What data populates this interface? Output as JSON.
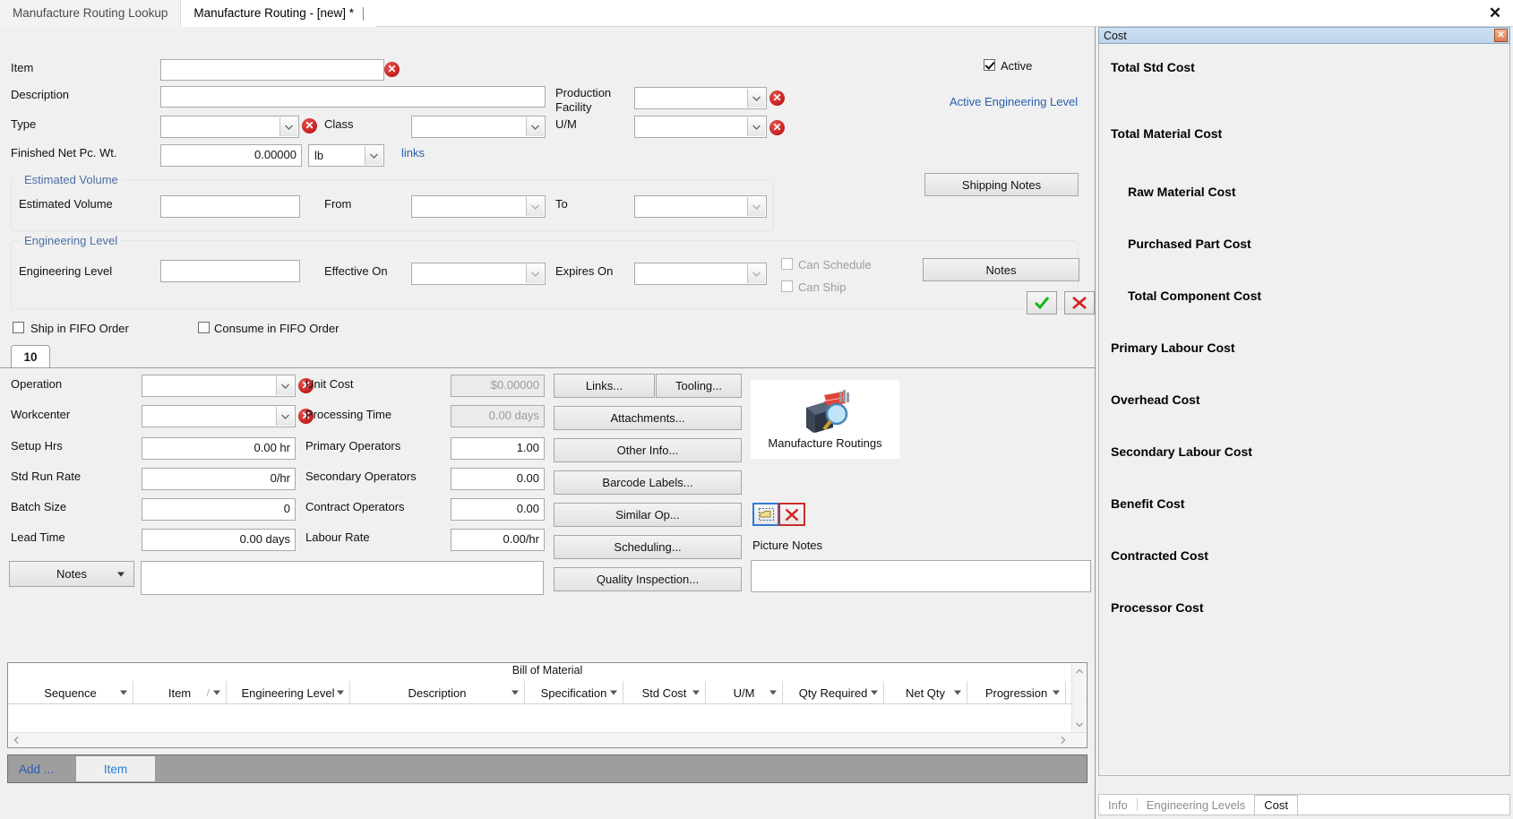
{
  "window": {
    "close_label": "✕"
  },
  "tabs": [
    {
      "label": "Manufacture Routing Lookup",
      "active": false
    },
    {
      "label": "Manufacture Routing - [new] *",
      "active": true
    }
  ],
  "header": {
    "item_label": "Item",
    "item_value": "",
    "description_label": "Description",
    "description_value": "",
    "type_label": "Type",
    "type_value": "",
    "class_label": "Class",
    "class_value": "",
    "finished_net_label": "Finished Net Pc. Wt.",
    "finished_net_value": "0.00000",
    "uom_unit_value": "lb",
    "links_label": "links",
    "production_facility_label_1": "Production",
    "production_facility_label_2": "Facility",
    "production_facility_value": "",
    "um_label": "U/M",
    "um_value": "",
    "active_label": "Active",
    "active_engineering_level_link": "Active Engineering Level",
    "shipping_notes_button": "Shipping Notes",
    "notes_button": "Notes",
    "error_badge": "✕"
  },
  "estimated_volume": {
    "group_title": "Estimated Volume",
    "field_label": "Estimated Volume",
    "field_value": "",
    "from_label": "From",
    "from_value": "",
    "to_label": "To",
    "to_value": ""
  },
  "engineering_level": {
    "group_title": "Engineering Level",
    "field_label": "Engineering Level",
    "field_value": "",
    "effective_on_label": "Effective On",
    "effective_on_value": "",
    "expires_on_label": "Expires On",
    "expires_on_value": "",
    "can_schedule_label": "Can Schedule",
    "can_ship_label": "Can Ship"
  },
  "fifo": {
    "ship_label": "Ship in FIFO Order",
    "consume_label": "Consume in FIFO Order"
  },
  "operation": {
    "tab_label": "10",
    "operation_label": "Operation",
    "operation_value": "",
    "workcenter_label": "Workcenter",
    "workcenter_value": "",
    "setup_hrs_label": "Setup Hrs",
    "setup_hrs_value": "0.00 hr",
    "std_run_rate_label": "Std Run Rate",
    "std_run_rate_value": "0/hr",
    "batch_size_label": "Batch Size",
    "batch_size_value": "0",
    "lead_time_label": "Lead Time",
    "lead_time_value": "0.00 days",
    "unit_cost_label": "Unit Cost",
    "unit_cost_value": "$0.00000",
    "processing_time_label": "Processing Time",
    "processing_time_value": "0.00 days",
    "primary_operators_label": "Primary Operators",
    "primary_operators_value": "1.00",
    "secondary_operators_label": "Secondary Operators",
    "secondary_operators_value": "0.00",
    "contract_operators_label": "Contract Operators",
    "contract_operators_value": "0.00",
    "labour_rate_label": "Labour Rate",
    "labour_rate_value": "0.00/hr",
    "notes_dropdown_label": "Notes",
    "notes_text_value": "",
    "picture_caption": "Manufacture Routings",
    "picture_notes_label": "Picture Notes",
    "picture_notes_value": "",
    "buttons": [
      "Links...",
      "Tooling...",
      "Attachments...",
      "Other Info...",
      "Barcode Labels...",
      "Similar Op...",
      "Scheduling...",
      "Quality Inspection..."
    ]
  },
  "bom": {
    "title": "Bill of Material",
    "columns": [
      "Sequence",
      "Item",
      "Engineering Level",
      "Description",
      "Specification",
      "Std Cost",
      "U/M",
      "Qty Required",
      "Net Qty",
      "Progression"
    ],
    "rows": [],
    "add_label": "Add ...",
    "item_tab_label": "Item"
  },
  "cost_panel": {
    "title": "Cost",
    "close_label": "✕",
    "rows": [
      {
        "label": "Total Std Cost",
        "indent": 0
      },
      {
        "label": "Total Material Cost",
        "indent": 0
      },
      {
        "label": "Raw Material Cost",
        "indent": 1
      },
      {
        "label": "Purchased Part Cost",
        "indent": 1
      },
      {
        "label": "Total Component Cost",
        "indent": 1
      },
      {
        "label": "Primary Labour Cost",
        "indent": 0
      },
      {
        "label": "Overhead Cost",
        "indent": 0
      },
      {
        "label": "Secondary Labour Cost",
        "indent": 0
      },
      {
        "label": "Benefit Cost",
        "indent": 0
      },
      {
        "label": "Contracted Cost",
        "indent": 0
      },
      {
        "label": "Processor Cost",
        "indent": 0
      }
    ],
    "tabs": [
      {
        "label": "Info",
        "active": false
      },
      {
        "label": "Engineering Levels",
        "active": false
      },
      {
        "label": "Cost",
        "active": true
      }
    ]
  },
  "colors": {
    "accent_link": "#2a5db0",
    "group_title": "#4a6fa5",
    "error_red": "#c41e1e",
    "ok_green": "#14b814",
    "panel_bg": "#f0f0f0"
  }
}
